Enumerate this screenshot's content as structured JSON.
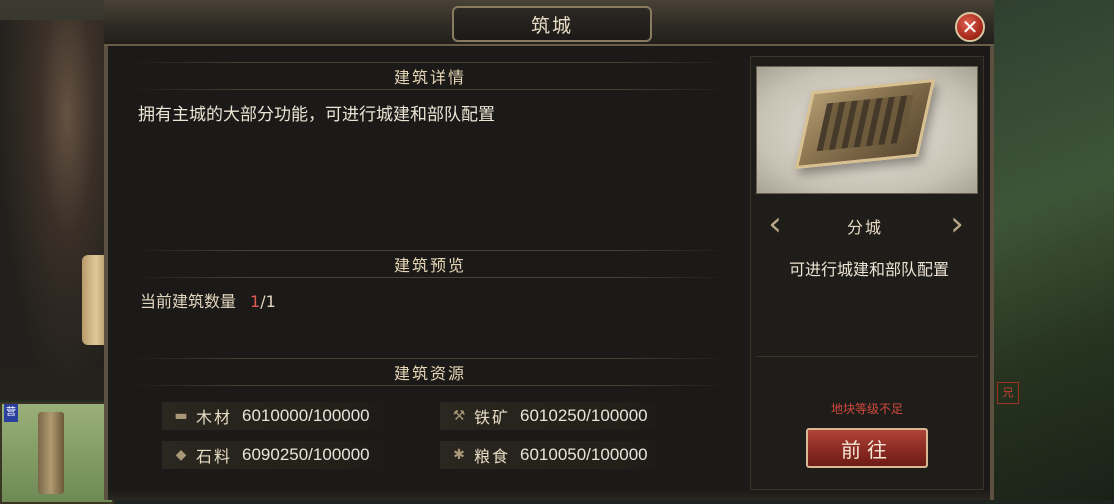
{
  "window": {
    "title": "筑城",
    "close_icon": "close-icon"
  },
  "details": {
    "header": "建筑详情",
    "description": "拥有主城的大部分功能，可进行城建和部队配置"
  },
  "preview": {
    "header": "建筑预览",
    "count_label": "当前建筑数量",
    "count_current": "1",
    "count_max": "/1"
  },
  "resources": {
    "header": "建筑资源",
    "items": [
      {
        "icon": "wood-icon",
        "name": "木材",
        "value": "6010000/100000"
      },
      {
        "icon": "iron-icon",
        "name": "铁矿",
        "value": "6010250/100000"
      },
      {
        "icon": "stone-icon",
        "name": "石料",
        "value": "6090250/100000"
      },
      {
        "icon": "grain-icon",
        "name": "粮食",
        "value": "6010050/100000"
      }
    ]
  },
  "building": {
    "name": "分城",
    "description": "可进行城建和部队配置",
    "warning": "地块等级不足",
    "go_button": "前往",
    "prev_icon": "chevron-left-icon",
    "next_icon": "chevron-right-icon"
  },
  "background": {
    "tile_badge": "营",
    "right_tag": "兄"
  },
  "colors": {
    "accent_red": "#d0483c",
    "count_red": "#e05a50",
    "text_light": "#ece4d4",
    "border": "#5c5040"
  }
}
